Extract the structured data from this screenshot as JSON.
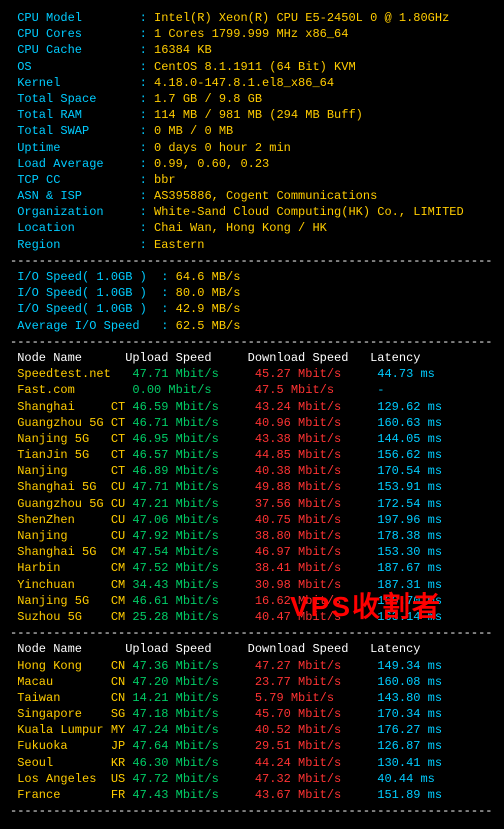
{
  "sys": [
    {
      "label": "CPU Model",
      "value": "Intel(R) Xeon(R) CPU E5-2450L 0 @ 1.80GHz"
    },
    {
      "label": "CPU Cores",
      "value": "1 Cores 1799.999 MHz x86_64"
    },
    {
      "label": "CPU Cache",
      "value": "16384 KB"
    },
    {
      "label": "OS",
      "value": "CentOS 8.1.1911 (64 Bit) KVM"
    },
    {
      "label": "Kernel",
      "value": "4.18.0-147.8.1.el8_x86_64"
    },
    {
      "label": "Total Space",
      "value": "1.7 GB / 9.8 GB"
    },
    {
      "label": "Total RAM",
      "value": "114 MB / 981 MB (294 MB Buff)"
    },
    {
      "label": "Total SWAP",
      "value": "0 MB / 0 MB"
    },
    {
      "label": "Uptime",
      "value": "0 days 0 hour 2 min"
    },
    {
      "label": "Load Average",
      "value": "0.99, 0.60, 0.23"
    },
    {
      "label": "TCP CC",
      "value": "bbr"
    },
    {
      "label": "ASN & ISP",
      "value": "AS395886, Cogent Communications"
    },
    {
      "label": "Organization",
      "value": "White-Sand Cloud Computing(HK) Co., LIMITED"
    },
    {
      "label": "Location",
      "value": "Chai Wan, Hong Kong / HK"
    },
    {
      "label": "Region",
      "value": "Eastern"
    }
  ],
  "io": [
    {
      "label": "I/O Speed( 1.0GB )",
      "value": "64.6 MB/s"
    },
    {
      "label": "I/O Speed( 1.0GB )",
      "value": "80.0 MB/s"
    },
    {
      "label": "I/O Speed( 1.0GB )",
      "value": "42.9 MB/s"
    },
    {
      "label": "Average I/O Speed",
      "value": "62.5 MB/s"
    }
  ],
  "hdr": {
    "node": "Node Name",
    "up": "Upload Speed",
    "down": "Download Speed",
    "lat": "Latency"
  },
  "t1": [
    {
      "node": "Speedtest.net",
      "cc": "",
      "up": "47.71 Mbit/s",
      "down": "45.27 Mbit/s",
      "lat": "44.73 ms"
    },
    {
      "node": "Fast.com",
      "cc": "",
      "up": "0.00 Mbit/s",
      "down": "47.5 Mbit/s",
      "lat": "-"
    },
    {
      "node": "Shanghai",
      "cc": "CT",
      "up": "46.59 Mbit/s",
      "down": "43.24 Mbit/s",
      "lat": "129.62 ms"
    },
    {
      "node": "Guangzhou 5G",
      "cc": "CT",
      "up": "46.71 Mbit/s",
      "down": "40.96 Mbit/s",
      "lat": "160.63 ms"
    },
    {
      "node": "Nanjing 5G",
      "cc": "CT",
      "up": "46.95 Mbit/s",
      "down": "43.38 Mbit/s",
      "lat": "144.05 ms"
    },
    {
      "node": "TianJin 5G",
      "cc": "CT",
      "up": "46.57 Mbit/s",
      "down": "44.85 Mbit/s",
      "lat": "156.62 ms"
    },
    {
      "node": "Nanjing",
      "cc": "CT",
      "up": "46.89 Mbit/s",
      "down": "40.38 Mbit/s",
      "lat": "170.54 ms"
    },
    {
      "node": "Shanghai 5G",
      "cc": "CU",
      "up": "47.71 Mbit/s",
      "down": "49.88 Mbit/s",
      "lat": "153.91 ms"
    },
    {
      "node": "Guangzhou 5G",
      "cc": "CU",
      "up": "47.21 Mbit/s",
      "down": "37.56 Mbit/s",
      "lat": "172.54 ms"
    },
    {
      "node": "ShenZhen",
      "cc": "CU",
      "up": "47.06 Mbit/s",
      "down": "40.75 Mbit/s",
      "lat": "197.96 ms"
    },
    {
      "node": "Nanjing",
      "cc": "CU",
      "up": "47.92 Mbit/s",
      "down": "38.80 Mbit/s",
      "lat": "178.38 ms"
    },
    {
      "node": "Shanghai 5G",
      "cc": "CM",
      "up": "47.54 Mbit/s",
      "down": "46.97 Mbit/s",
      "lat": "153.30 ms"
    },
    {
      "node": "Harbin",
      "cc": "CM",
      "up": "47.52 Mbit/s",
      "down": "38.41 Mbit/s",
      "lat": "187.67 ms"
    },
    {
      "node": "Yinchuan",
      "cc": "CM",
      "up": "34.43 Mbit/s",
      "down": "30.98 Mbit/s",
      "lat": "187.31 ms"
    },
    {
      "node": "Nanjing 5G",
      "cc": "CM",
      "up": "46.61 Mbit/s",
      "down": "16.62 Mbit/s",
      "lat": "169.70 ms"
    },
    {
      "node": "Suzhou 5G",
      "cc": "CM",
      "up": "25.28 Mbit/s",
      "down": "40.47 Mbit/s",
      "lat": "163.14 ms"
    }
  ],
  "t2": [
    {
      "node": "Hong Kong",
      "cc": "CN",
      "up": "47.36 Mbit/s",
      "down": "47.27 Mbit/s",
      "lat": "149.34 ms"
    },
    {
      "node": "Macau",
      "cc": "CN",
      "up": "47.20 Mbit/s",
      "down": "23.77 Mbit/s",
      "lat": "160.08 ms"
    },
    {
      "node": "Taiwan",
      "cc": "CN",
      "up": "14.21 Mbit/s",
      "down": "5.79 Mbit/s",
      "lat": "143.80 ms"
    },
    {
      "node": "Singapore",
      "cc": "SG",
      "up": "47.18 Mbit/s",
      "down": "45.70 Mbit/s",
      "lat": "170.34 ms"
    },
    {
      "node": "Kuala Lumpur",
      "cc": "MY",
      "up": "47.24 Mbit/s",
      "down": "40.52 Mbit/s",
      "lat": "176.27 ms"
    },
    {
      "node": "Fukuoka",
      "cc": "JP",
      "up": "47.64 Mbit/s",
      "down": "29.51 Mbit/s",
      "lat": "126.87 ms"
    },
    {
      "node": "Seoul",
      "cc": "KR",
      "up": "46.30 Mbit/s",
      "down": "44.24 Mbit/s",
      "lat": "130.41 ms"
    },
    {
      "node": "Los Angeles",
      "cc": "US",
      "up": "47.72 Mbit/s",
      "down": "47.32 Mbit/s",
      "lat": "40.44 ms"
    },
    {
      "node": "France",
      "cc": "FR",
      "up": "47.43 Mbit/s",
      "down": "43.67 Mbit/s",
      "lat": "151.89 ms"
    }
  ],
  "watermark": "VPS收割者"
}
